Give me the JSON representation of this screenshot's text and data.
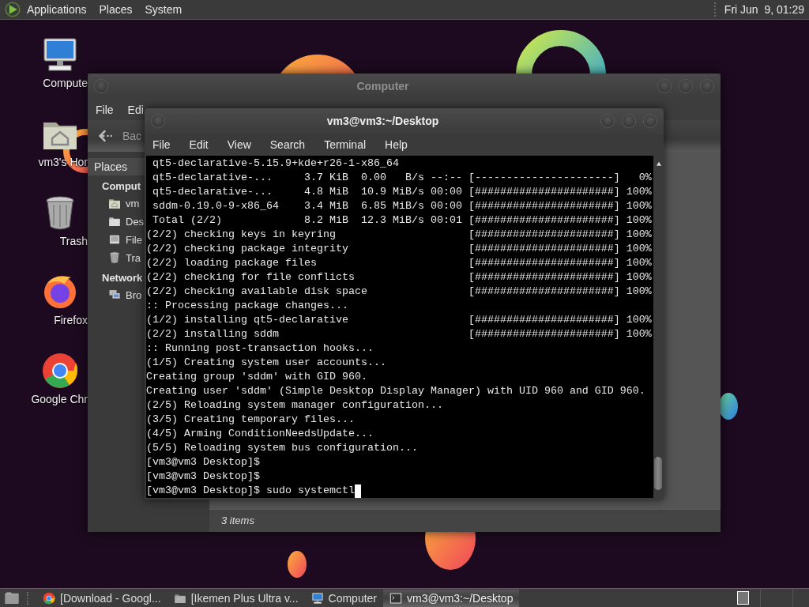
{
  "top_panel": {
    "menus": [
      "Applications",
      "Places",
      "System"
    ],
    "clock": "Fri Jun  9, 01:29"
  },
  "desktop_icons": [
    {
      "label": "Compute",
      "kind": "computer"
    },
    {
      "label": "vm3's Hor",
      "kind": "home"
    },
    {
      "label": "Trash",
      "kind": "trash"
    },
    {
      "label": "Firefox",
      "kind": "firefox"
    },
    {
      "label": "Google Chr",
      "kind": "chrome"
    }
  ],
  "file_manager": {
    "title": "Computer",
    "menus": [
      "File",
      "Edi"
    ],
    "back": "Bac",
    "sidebar_header": "Places",
    "sections": [
      {
        "label": "Comput",
        "items": [
          {
            "label": "vm",
            "kind": "home"
          },
          {
            "label": "Des",
            "kind": "desktop"
          },
          {
            "label": "File",
            "kind": "drive"
          },
          {
            "label": "Tra",
            "kind": "trash"
          }
        ]
      },
      {
        "label": "Network",
        "items": [
          {
            "label": "Bro",
            "kind": "network"
          }
        ]
      }
    ],
    "status": "3 items"
  },
  "terminal": {
    "title": "vm3@vm3:~/Desktop",
    "menus": [
      "File",
      "Edit",
      "View",
      "Search",
      "Terminal",
      "Help"
    ],
    "lines": [
      " qt5-declarative-5.15.9+kde+r26-1-x86_64",
      " qt5-declarative-...     3.7 KiB  0.00   B/s --:-- [----------------------]   0%",
      " qt5-declarative-...     4.8 MiB  10.9 MiB/s 00:00 [######################] 100%",
      " sddm-0.19.0-9-x86_64    3.4 MiB  6.85 MiB/s 00:00 [######################] 100%",
      " Total (2/2)             8.2 MiB  12.3 MiB/s 00:01 [######################] 100%",
      "(2/2) checking keys in keyring                     [######################] 100%",
      "(2/2) checking package integrity                   [######################] 100%",
      "(2/2) loading package files                        [######################] 100%",
      "(2/2) checking for file conflicts                  [######################] 100%",
      "(2/2) checking available disk space                [######################] 100%",
      ":: Processing package changes...",
      "(1/2) installing qt5-declarative                   [######################] 100%",
      "(2/2) installing sddm                              [######################] 100%",
      ":: Running post-transaction hooks...",
      "(1/5) Creating system user accounts...",
      "Creating group 'sddm' with GID 960.",
      "Creating user 'sddm' (Simple Desktop Display Manager) with UID 960 and GID 960.",
      "(2/5) Reloading system manager configuration...",
      "(3/5) Creating temporary files...",
      "(4/5) Arming ConditionNeedsUpdate...",
      "(5/5) Reloading system bus configuration...",
      "[vm3@vm3 Desktop]$",
      "[vm3@vm3 Desktop]$",
      "[vm3@vm3 Desktop]$ sudo systemctl"
    ]
  },
  "taskbar": {
    "tasks": [
      {
        "label": "[Download - Googl...",
        "kind": "chrome",
        "selected": false
      },
      {
        "label": "[Ikemen Plus Ultra v...",
        "kind": "folder",
        "selected": false
      },
      {
        "label": "Computer",
        "kind": "computer",
        "selected": false
      },
      {
        "label": "vm3@vm3:~/Desktop",
        "kind": "terminal",
        "selected": true
      }
    ]
  }
}
